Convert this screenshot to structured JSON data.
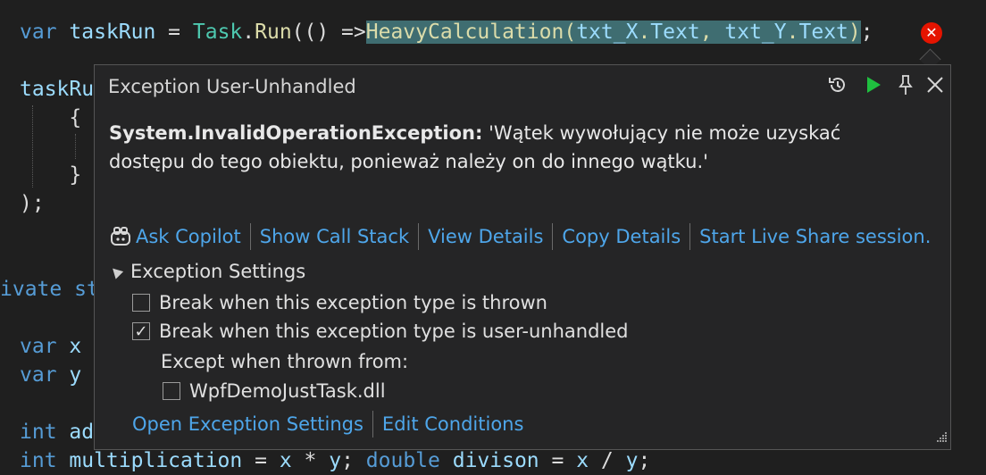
{
  "code": {
    "line1": {
      "kw_var": "var",
      "name": " taskRun ",
      "eq": "= ",
      "task": "Task",
      "dot": ".",
      "run": "Run",
      "open": "(() =>",
      "call": "HeavyCalculation",
      "args_open": "(",
      "arg1": "txt_X",
      "dot2": ".",
      "text1": "Text",
      "comma": ", ",
      "arg2": "txt_Y",
      "dot3": ".",
      "text2": "Text",
      "close": ");"
    },
    "line2": "taskRu",
    "line3": "    {",
    "line4": "    }",
    "line5": ");",
    "line6_kw": "ivate",
    "line6_rest": " st",
    "line7_kw": "var",
    "line7_rest": " x",
    "line8_kw": "var",
    "line8_rest": " y",
    "line9_kw": "int",
    "line9_rest": " ad",
    "line10": {
      "kw_int": "int",
      "mult": " multiplication",
      "eq": " = ",
      "x": "x",
      "op": " * ",
      "y": "y",
      "semi": "; ",
      "kw_double": "double",
      "div": " divison",
      "eq2": " = ",
      "x2": "x",
      "op2": " / ",
      "y2": "y",
      "semi2": ";"
    }
  },
  "error_glyph": "✕",
  "popup": {
    "title": "Exception User-Unhandled",
    "exception_type": "System.InvalidOperationException:",
    "exception_message": " 'Wątek wywołujący nie może uzyskać dostępu do tego obiektu, ponieważ należy on do innego wątku.'",
    "actions": [
      "Ask Copilot",
      "Show Call Stack",
      "View Details",
      "Copy Details",
      "Start Live Share session."
    ],
    "settings_title": "Exception Settings",
    "options": {
      "thrown": {
        "label": "Break when this exception type is thrown",
        "checked": false
      },
      "user_unhandled": {
        "label": "Break when this exception type is user-unhandled",
        "checked": true
      },
      "except_label": "Except when thrown from:",
      "module": {
        "label": "WpfDemoJustTask.dll",
        "checked": false
      }
    },
    "bottom_links": [
      "Open Exception Settings",
      "Edit Conditions"
    ],
    "check_glyph": "✓"
  },
  "colors": {
    "background": "#1f1f1f",
    "keyword": "#569cd6",
    "type": "#4ec9b0",
    "method": "#dcdcaa",
    "identifier": "#9cdcfe",
    "highlight": "#3f6d71",
    "link": "#4ea6ea",
    "error": "#e51400",
    "run_icon": "#1fbf3f"
  }
}
